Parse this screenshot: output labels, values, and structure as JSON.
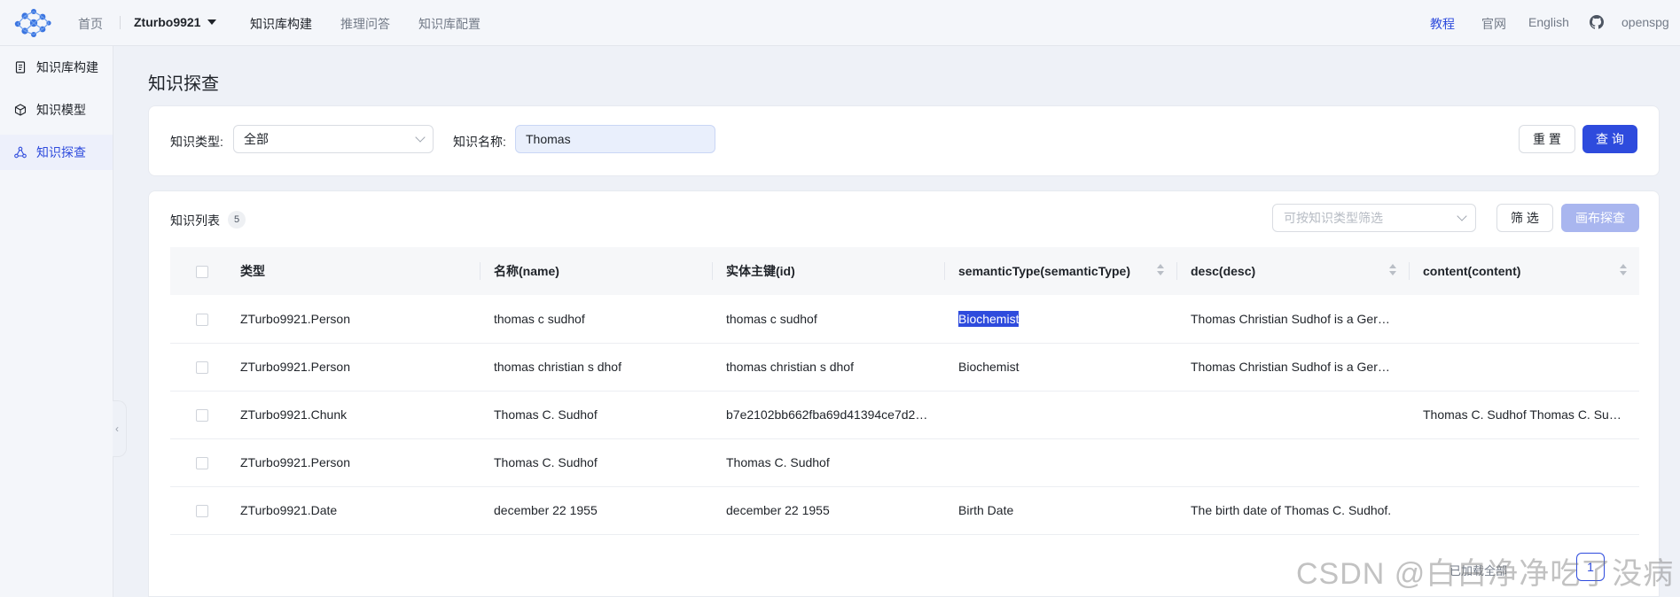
{
  "topnav": {
    "home": "首页",
    "project": "Zturbo9921",
    "build": "知识库构建",
    "qa": "推理问答",
    "config": "知识库配置",
    "tutorial": "教程",
    "website": "官网",
    "lang": "English",
    "github_label": "openspg"
  },
  "sidebar": {
    "items": [
      {
        "label": "知识库构建",
        "icon": "document-icon"
      },
      {
        "label": "知识模型",
        "icon": "cube-icon"
      },
      {
        "label": "知识探查",
        "icon": "graph-icon"
      }
    ]
  },
  "page": {
    "title": "知识探查"
  },
  "search": {
    "type_label": "知识类型:",
    "type_value": "全部",
    "name_label": "知识名称:",
    "name_value": "Thomas",
    "reset_label": "重 置",
    "query_label": "查 询"
  },
  "list": {
    "title": "知识列表",
    "count": "5",
    "filter_placeholder": "可按知识类型筛选",
    "filter_button": "筛 选",
    "canvas_button": "画布探查",
    "columns": [
      "类型",
      "名称(name)",
      "实体主键(id)",
      "semanticType(semanticType)",
      "desc(desc)",
      "content(content)"
    ],
    "rows": [
      {
        "type": "ZTurbo9921.Person",
        "name": "thomas c sudhof",
        "id": "thomas c sudhof",
        "semantic": "Biochemist",
        "desc": "Thomas Christian Sudhof is a Germ...",
        "content": ""
      },
      {
        "type": "ZTurbo9921.Person",
        "name": "thomas christian s dhof",
        "id": "thomas christian s dhof",
        "semantic": "Biochemist",
        "desc": "Thomas Christian Sudhof is a Germ...",
        "content": ""
      },
      {
        "type": "ZTurbo9921.Chunk",
        "name": "Thomas C. Sudhof",
        "id": "b7e2102bb662fba69d41394ce7d27...",
        "semantic": "",
        "desc": "",
        "content": "Thomas C. Sudhof Thomas C. Sudh..."
      },
      {
        "type": "ZTurbo9921.Person",
        "name": "Thomas C. Sudhof",
        "id": "Thomas C. Sudhof",
        "semantic": "",
        "desc": "",
        "content": ""
      },
      {
        "type": "ZTurbo9921.Date",
        "name": "december 22 1955",
        "id": "december 22 1955",
        "semantic": "Birth Date",
        "desc": "The birth date of Thomas C. Sudhof.",
        "content": ""
      }
    ]
  },
  "pagination": {
    "text": "已加载全部",
    "current": "1"
  },
  "watermark": "CSDN @白白净净吃了没病",
  "colors": {
    "accent": "#2e4bdd",
    "background": "#eef1f7"
  }
}
